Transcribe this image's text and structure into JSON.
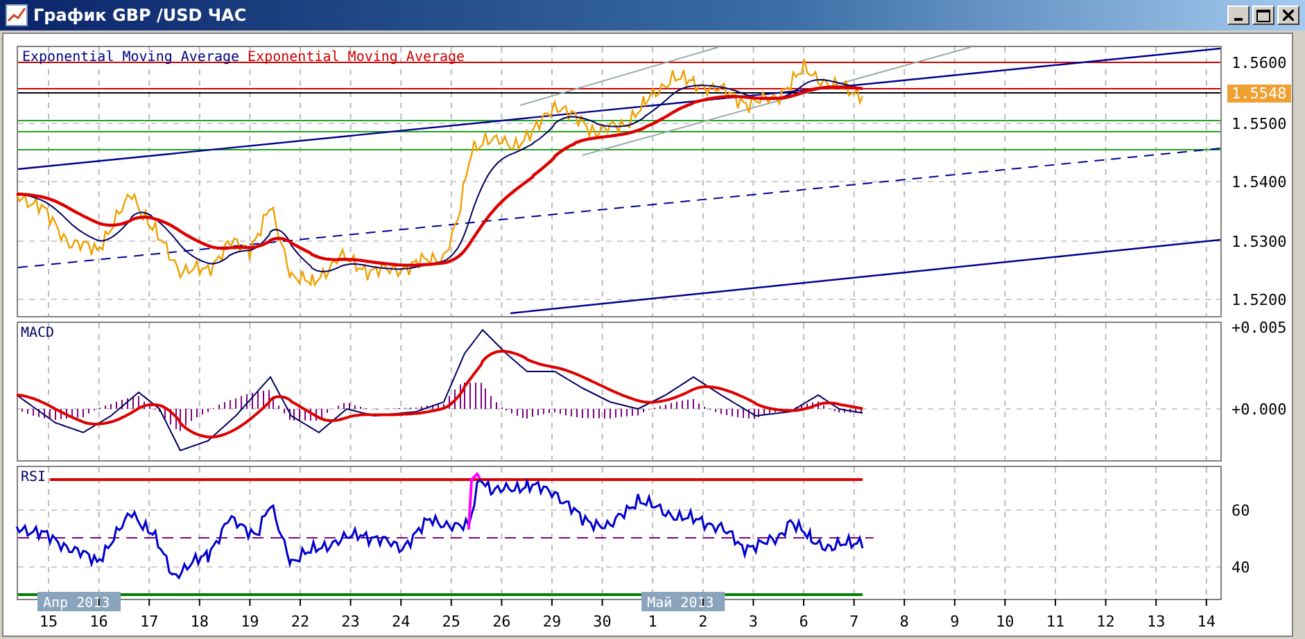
{
  "window": {
    "title": "График GBP /USD ЧАС"
  },
  "main_panel": {
    "legend": [
      {
        "label": "Exponential Moving Average",
        "color": "#000080"
      },
      {
        "label": "Exponential Moving Average",
        "color": "#cc0000"
      }
    ],
    "price_axis": [
      "1.5600",
      "1.5500",
      "1.5400",
      "1.5300",
      "1.5200"
    ],
    "current_price": "1.5548"
  },
  "macd_panel": {
    "label": "MACD",
    "axis": [
      "+0.005",
      "+0.000"
    ]
  },
  "rsi_panel": {
    "label": "RSI",
    "axis": [
      "60",
      "40"
    ]
  },
  "time_axis": {
    "days": [
      {
        "label": "15",
        "month": "Апр 2013"
      },
      {
        "label": "16"
      },
      {
        "label": "17"
      },
      {
        "label": "18"
      },
      {
        "label": "19"
      },
      {
        "label": "22"
      },
      {
        "label": "23"
      },
      {
        "label": "24"
      },
      {
        "label": "25"
      },
      {
        "label": "26"
      },
      {
        "label": "29"
      },
      {
        "label": "30"
      },
      {
        "label": "1",
        "month": "Май 2013"
      },
      {
        "label": "2"
      },
      {
        "label": "3"
      },
      {
        "label": "6"
      },
      {
        "label": "7"
      },
      {
        "label": "8"
      },
      {
        "label": "9"
      },
      {
        "label": "10"
      },
      {
        "label": "11"
      },
      {
        "label": "12"
      },
      {
        "label": "13"
      },
      {
        "label": "14"
      }
    ]
  }
}
